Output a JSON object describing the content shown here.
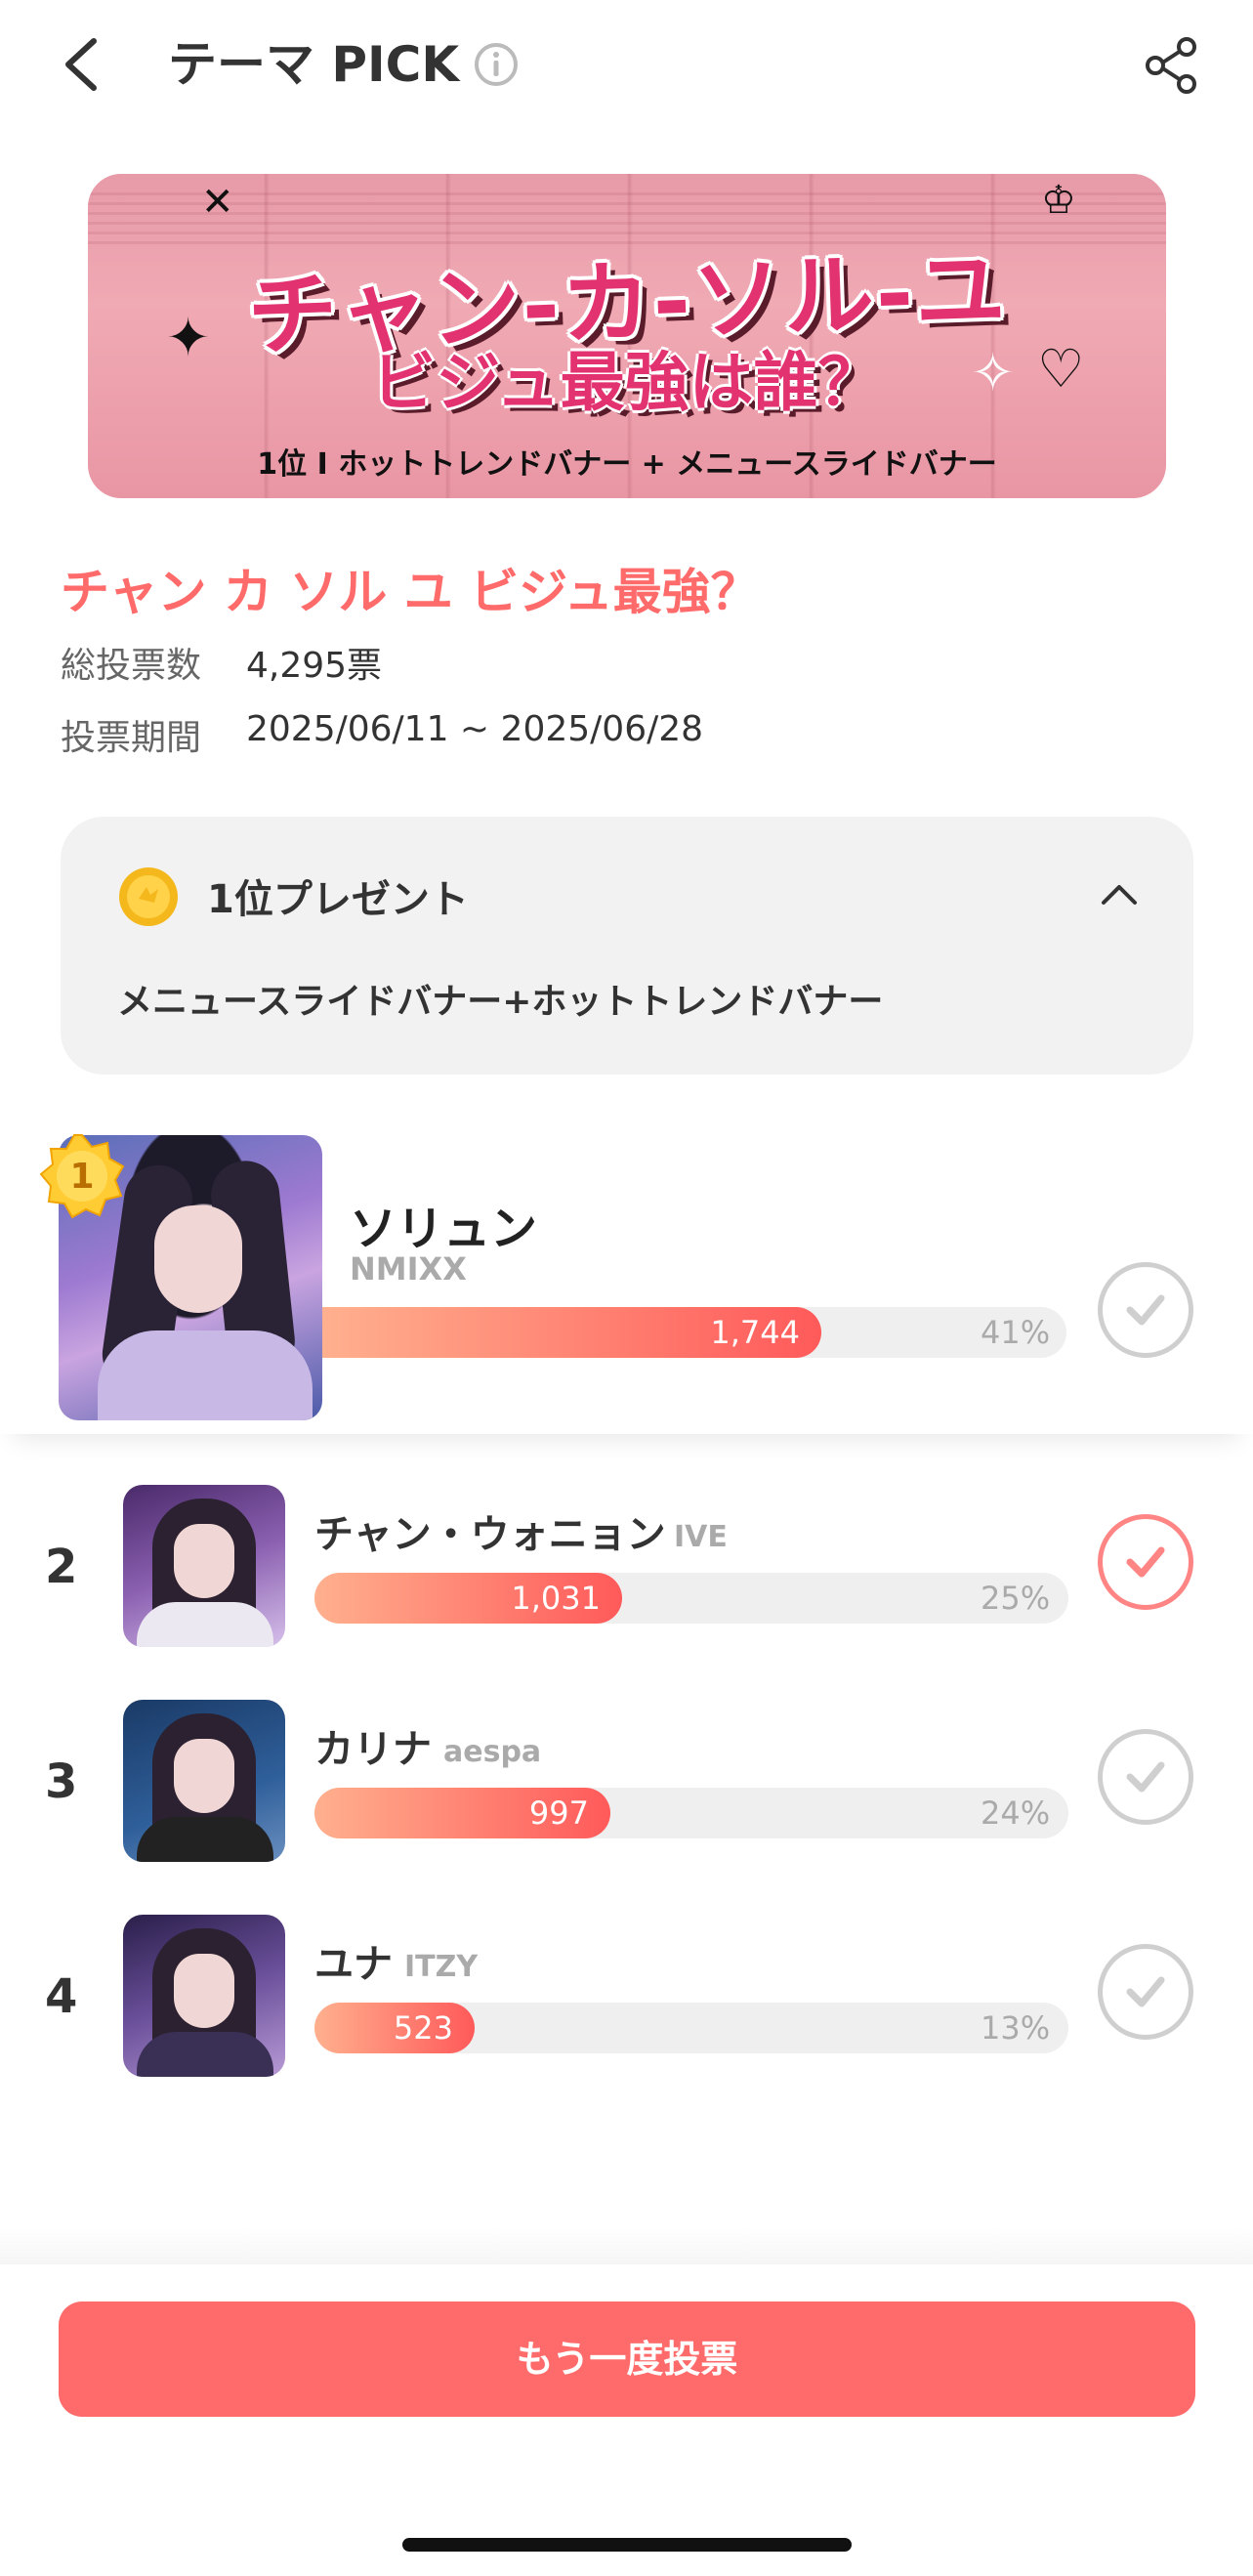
{
  "header": {
    "title": "テーマ PICK",
    "back_icon": "chevron-left-icon",
    "info_icon": "info-icon",
    "share_icon": "share-icon"
  },
  "banner": {
    "line1": "チャン-カ-ソル-ユ",
    "line2": "ビジュ最強は誰？",
    "line3": "1位 I ホットトレンドバナー + メニュースライドバナー"
  },
  "poll": {
    "title": "チャン カ ソル ユ ビジュ最強？",
    "total_label": "総投票数",
    "total_value": "4,295票",
    "period_label": "投票期間",
    "period_value": "2025/06/11 ~ 2025/06/28"
  },
  "reward": {
    "icon": "coin-icon",
    "title": "1位プレゼント",
    "description": "メニュースライドバナー+ホットトレンドバナー",
    "expanded": true
  },
  "first_place": {
    "rank_badge": "1",
    "name": "ソリュン",
    "group": "NMIXX",
    "votes": "1,744",
    "percent_label": "41%",
    "percent": 41,
    "selected": false
  },
  "ranks": [
    {
      "rank": "2",
      "name": "チャン・ウォニョン",
      "group": "IVE",
      "votes": "1,031",
      "percent_label": "25%",
      "percent": 25,
      "selected": true
    },
    {
      "rank": "3",
      "name": "カリナ",
      "group": "aespa",
      "votes": "997",
      "percent_label": "24%",
      "percent": 24,
      "selected": false
    },
    {
      "rank": "4",
      "name": "ユナ",
      "group": "ITZY",
      "votes": "523",
      "percent_label": "13%",
      "percent": 13,
      "selected": false
    }
  ],
  "footer": {
    "vote_again_label": "もう一度投票"
  },
  "colors": {
    "accent": "#ff6b6b",
    "bar_start": "#ffb08e",
    "bar_end": "#ff5a5a",
    "reward_bg": "#f2f2f2"
  }
}
